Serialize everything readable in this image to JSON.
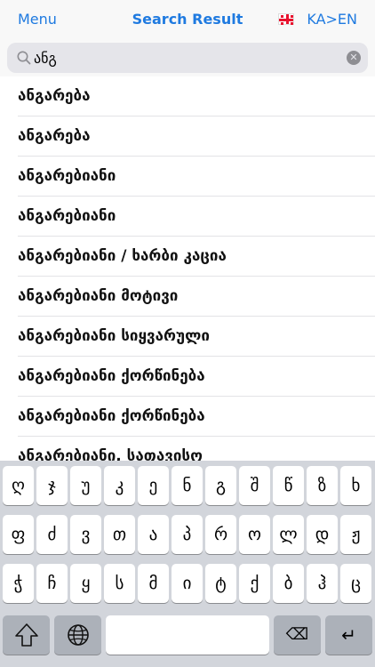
{
  "nav": {
    "menu_label": "Menu",
    "title": "Search Result",
    "lang_label": "KA>EN"
  },
  "search": {
    "value": "ანგ"
  },
  "results": [
    "ანგარება",
    "ანგარება",
    "ანგარებიანი",
    "ანგარებიანი",
    "ანგარებიანი / ხარბი კაცია",
    "ანგარებიანი მოტივი",
    "ანგარებიანი სიყვარული",
    "ანგარებიანი ქორწინება",
    "ანგარებიანი ქორწინება",
    "ანგარებიანი, სათავისო"
  ],
  "keyboard": {
    "row1": [
      "ღ",
      "ჯ",
      "უ",
      "კ",
      "ე",
      "ნ",
      "გ",
      "შ",
      "წ",
      "ზ",
      "ხ"
    ],
    "row2": [
      "ფ",
      "ძ",
      "ვ",
      "თ",
      "ა",
      "პ",
      "რ",
      "ო",
      "ლ",
      "დ",
      "ჟ"
    ],
    "row3": [
      "ჭ",
      "ჩ",
      "ყ",
      "ს",
      "მ",
      "ი",
      "ტ",
      "ქ",
      "ბ",
      "ჰ",
      "ც"
    ],
    "delete_glyph": "⌫",
    "return_glyph": "↵"
  }
}
